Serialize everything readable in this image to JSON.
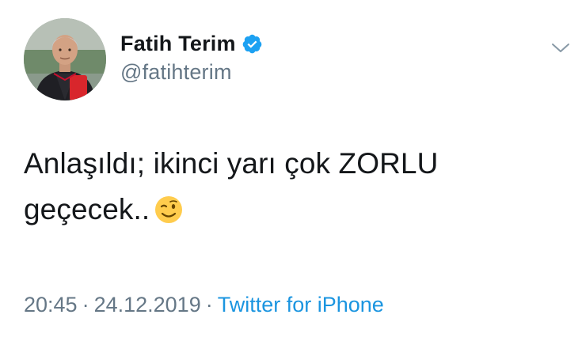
{
  "user": {
    "display_name": "Fatih Terim",
    "handle": "@fatihterim",
    "verified": true,
    "avatar_icon": "profile-photo"
  },
  "tweet": {
    "line1": "Anlaşıldı; ikinci yarı çok ZORLU",
    "line2": "geçecek..",
    "emoji": "winking-face"
  },
  "meta": {
    "time": "20:45",
    "separator": "·",
    "date": "24.12.2019",
    "source": "Twitter for iPhone"
  },
  "colors": {
    "text": "#14171a",
    "secondary": "#657786",
    "accent": "#1b95e0",
    "verified": "#1da1f2"
  },
  "icons": {
    "menu": "chevron-down-icon",
    "verified": "verified-badge-icon"
  }
}
